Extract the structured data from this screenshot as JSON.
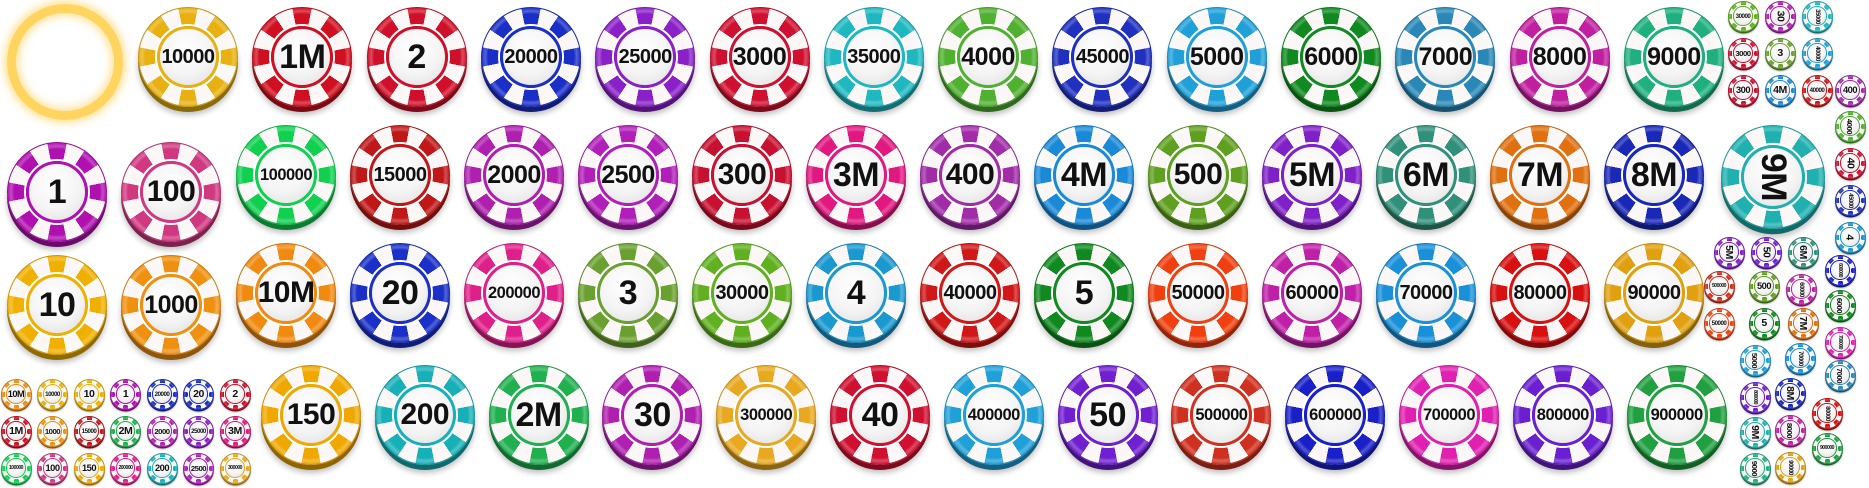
{
  "glow_ring": {
    "color": "#ffd560"
  },
  "large_chips": [
    {
      "label": "10000",
      "color": "#e8b010"
    },
    {
      "label": "1M",
      "color": "#d01020"
    },
    {
      "label": "2",
      "color": "#d0102a"
    },
    {
      "label": "20000",
      "color": "#1a2ec8"
    },
    {
      "label": "25000",
      "color": "#8a20c8"
    },
    {
      "label": "3000",
      "color": "#d01030"
    },
    {
      "label": "35000",
      "color": "#20b8c0"
    },
    {
      "label": "4000",
      "color": "#50b030"
    },
    {
      "label": "45000",
      "color": "#2030c0"
    },
    {
      "label": "5000",
      "color": "#20a0d8"
    },
    {
      "label": "6000",
      "color": "#108a20"
    },
    {
      "label": "7000",
      "color": "#2a88b8"
    },
    {
      "label": "8000",
      "color": "#c020a0"
    },
    {
      "label": "9000",
      "color": "#20b080"
    },
    {
      "label": "1",
      "color": "#b010b0"
    },
    {
      "label": "100",
      "color": "#d03880"
    },
    {
      "label": "100000",
      "color": "#10d050"
    },
    {
      "label": "15000",
      "color": "#c01818"
    },
    {
      "label": "2000",
      "color": "#b020b0"
    },
    {
      "label": "2500",
      "color": "#b020b8"
    },
    {
      "label": "300",
      "color": "#c81030"
    },
    {
      "label": "3M",
      "color": "#e01880"
    },
    {
      "label": "400",
      "color": "#a02ca8"
    },
    {
      "label": "4M",
      "color": "#1a8ad8"
    },
    {
      "label": "500",
      "color": "#60a020"
    },
    {
      "label": "5M",
      "color": "#8020c8"
    },
    {
      "label": "6M",
      "color": "#30907a"
    },
    {
      "label": "7M",
      "color": "#e07010"
    },
    {
      "label": "8M",
      "color": "#1a28b8"
    },
    {
      "label": "9M",
      "color": "#20b0b0"
    },
    {
      "label": "10",
      "color": "#f0b000"
    },
    {
      "label": "1000",
      "color": "#f09010"
    },
    {
      "label": "10M",
      "color": "#f08a10"
    },
    {
      "label": "20",
      "color": "#1a30c8"
    },
    {
      "label": "200000",
      "color": "#e0208a"
    },
    {
      "label": "3",
      "color": "#6aa030"
    },
    {
      "label": "30000",
      "color": "#60b020"
    },
    {
      "label": "4",
      "color": "#1a98d0"
    },
    {
      "label": "40000",
      "color": "#d01818"
    },
    {
      "label": "5",
      "color": "#108a20"
    },
    {
      "label": "50000",
      "color": "#f04010"
    },
    {
      "label": "60000",
      "color": "#c020a8"
    },
    {
      "label": "70000",
      "color": "#1a90d8"
    },
    {
      "label": "80000",
      "color": "#d81010"
    },
    {
      "label": "90000",
      "color": "#e0a010"
    },
    {
      "label": "150",
      "color": "#f0a800"
    },
    {
      "label": "200",
      "color": "#18b0b8"
    },
    {
      "label": "2M",
      "color": "#20b050"
    },
    {
      "label": "30",
      "color": "#b020b0"
    },
    {
      "label": "300000",
      "color": "#e8a820"
    },
    {
      "label": "40",
      "color": "#d01030"
    },
    {
      "label": "400000",
      "color": "#20a0d8"
    },
    {
      "label": "50",
      "color": "#7020d0"
    },
    {
      "label": "500000",
      "color": "#d03020"
    },
    {
      "label": "600000",
      "color": "#1a20c8"
    },
    {
      "label": "700000",
      "color": "#e020b0"
    },
    {
      "label": "800000",
      "color": "#6a20d0"
    },
    {
      "label": "900000",
      "color": "#20a040"
    }
  ],
  "small_chips": [
    {
      "label": "10M",
      "color": "#f08a10"
    },
    {
      "label": "10000",
      "color": "#e8b010"
    },
    {
      "label": "10",
      "color": "#f0b000"
    },
    {
      "label": "1",
      "color": "#b010b0"
    },
    {
      "label": "20000",
      "color": "#1a2ec8"
    },
    {
      "label": "20",
      "color": "#1a30c8"
    },
    {
      "label": "2",
      "color": "#d0102a"
    },
    {
      "label": "1M",
      "color": "#d01020"
    },
    {
      "label": "1000",
      "color": "#f09010"
    },
    {
      "label": "15000",
      "color": "#c01818"
    },
    {
      "label": "2M",
      "color": "#20b050"
    },
    {
      "label": "2000",
      "color": "#b020b0"
    },
    {
      "label": "25000",
      "color": "#8a20c8"
    },
    {
      "label": "3M",
      "color": "#e01880"
    },
    {
      "label": "100000",
      "color": "#10d050"
    },
    {
      "label": "100",
      "color": "#d03880"
    },
    {
      "label": "150",
      "color": "#f0a800"
    },
    {
      "label": "200000",
      "color": "#e0208a"
    },
    {
      "label": "200",
      "color": "#18b0b8"
    },
    {
      "label": "2500",
      "color": "#b020b8"
    },
    {
      "label": "300000",
      "color": "#e8a820"
    },
    {
      "label": "30000",
      "color": "#60b020"
    },
    {
      "label": "30",
      "color": "#b020b0",
      "rotated": true
    },
    {
      "label": "35000",
      "color": "#20b8c0",
      "rotated": true
    },
    {
      "label": "3000",
      "color": "#d01030"
    },
    {
      "label": "3",
      "color": "#6aa030"
    },
    {
      "label": "40000",
      "color": "#20a0d8",
      "rotated": true
    },
    {
      "label": "300",
      "color": "#c81030"
    },
    {
      "label": "4M",
      "color": "#1a8ad8"
    },
    {
      "label": "40000",
      "color": "#d01818"
    },
    {
      "label": "400",
      "color": "#a02ca8"
    },
    {
      "label": "4000",
      "color": "#50b030",
      "rotated": true
    },
    {
      "label": "40",
      "color": "#d01030",
      "rotated": true
    },
    {
      "label": "45000",
      "color": "#2030c0",
      "rotated": true
    },
    {
      "label": "4",
      "color": "#1a98d0",
      "rotated": true
    },
    {
      "label": "5M",
      "color": "#8020c8",
      "rotated": true
    },
    {
      "label": "50",
      "color": "#7020d0",
      "rotated": true
    },
    {
      "label": "6M",
      "color": "#30907a",
      "rotated": true
    },
    {
      "label": "600000",
      "color": "#1a20c8",
      "rotated": true
    },
    {
      "label": "500000",
      "color": "#d03020"
    },
    {
      "label": "500",
      "color": "#60a020"
    },
    {
      "label": "60000",
      "color": "#c020a8",
      "rotated": true
    },
    {
      "label": "6000",
      "color": "#108a20",
      "rotated": true
    },
    {
      "label": "50000",
      "color": "#f04010"
    },
    {
      "label": "5",
      "color": "#108a20"
    },
    {
      "label": "7M",
      "color": "#e07010",
      "rotated": true
    },
    {
      "label": "700000",
      "color": "#e020b0",
      "rotated": true
    },
    {
      "label": "5000",
      "color": "#20a0d8",
      "rotated": true
    },
    {
      "label": "70000",
      "color": "#1a90d8",
      "rotated": true
    },
    {
      "label": "7000",
      "color": "#2a88b8",
      "rotated": true
    },
    {
      "label": "800000",
      "color": "#6a20d0",
      "rotated": true
    },
    {
      "label": "8M",
      "color": "#1a28b8",
      "rotated": true
    },
    {
      "label": "80000",
      "color": "#d81010",
      "rotated": true
    },
    {
      "label": "9M",
      "color": "#20b0b0",
      "rotated": true
    },
    {
      "label": "8000",
      "color": "#c020a0",
      "rotated": true
    },
    {
      "label": "900000",
      "color": "#20a040"
    },
    {
      "label": "9000",
      "color": "#20b080",
      "rotated": true
    },
    {
      "label": "90000",
      "color": "#e0a010",
      "rotated": true
    }
  ]
}
